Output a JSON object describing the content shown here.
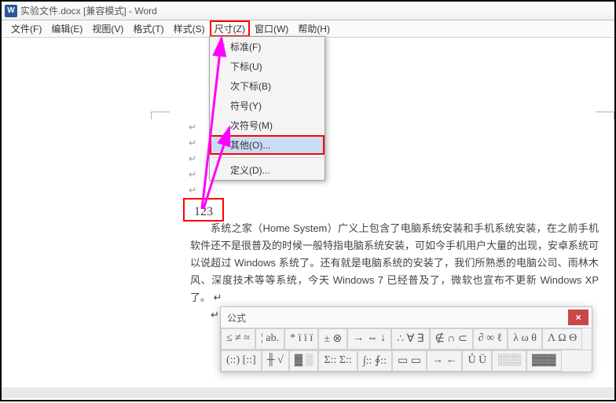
{
  "titlebar": {
    "title": "实验文件.docx [兼容模式] - Word"
  },
  "menubar": {
    "items": [
      {
        "label": "文件(F)"
      },
      {
        "label": "编辑(E)"
      },
      {
        "label": "视图(V)"
      },
      {
        "label": "格式(T)"
      },
      {
        "label": "样式(S)"
      },
      {
        "label": "尺寸(Z)"
      },
      {
        "label": "窗口(W)"
      },
      {
        "label": "帮助(H)"
      }
    ]
  },
  "dropdown": {
    "items": [
      {
        "label": "标准(F)",
        "checked": true
      },
      {
        "label": "下标(U)"
      },
      {
        "label": "次下标(B)"
      },
      {
        "label": "符号(Y)"
      },
      {
        "label": "次符号(M)"
      },
      {
        "label": "其他(O)...",
        "hover": true
      },
      {
        "label": "定义(D)..."
      }
    ]
  },
  "document": {
    "sample_number": "123",
    "paragraph1": "（Home System）广义上包含了电脑系统安装和手机系统安装，在之前手机软件还不是很普及的时候一般特指电脑系统安装，可如今手机用户大量的出现，安卓系统可以说超过 Windows 系统了。还有就是电脑系统的安装了，我们所熟悉的电脑公司、雨林木风、深度技术等等系统，今天 Windows 7 已经普及了，微软也宣布不更新 Windows XP 了。",
    "paragraph_prefix": "系统之家"
  },
  "formula": {
    "title": "公式",
    "close": "×",
    "row1": [
      "≤ ≠ ≈",
      "¦ ab.",
      "* ï ï ï",
      "± ⊗",
      "→ ⇔ ↓",
      "∴ ∀ ∃",
      "∉ ∩ ⊂",
      "∂ ∞ ℓ",
      "λ ω θ",
      "Λ Ω Θ"
    ],
    "row2": [
      "(::) [::]",
      "╫ √",
      "▓ ░",
      "Σ:: Σ::",
      "∫:: ∮::",
      "▭ ▭",
      "→ ←",
      "Ů Ü",
      "░░░",
      "▓▓▓"
    ]
  }
}
